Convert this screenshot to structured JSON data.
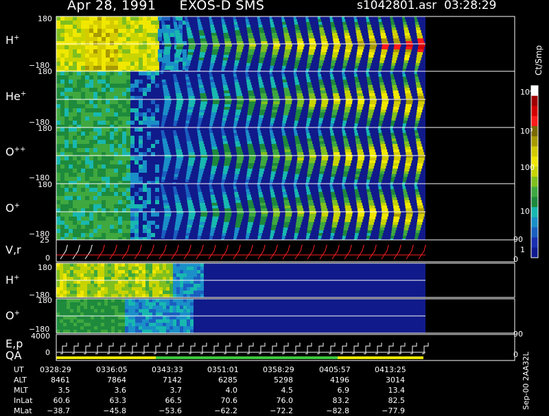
{
  "header": {
    "date": "Apr 28, 1991",
    "instrument": "EXOS-D SMS",
    "file": "s1042801.asr",
    "time": "03:28:29"
  },
  "panels": [
    {
      "label": "H",
      "sup": "+",
      "top_tick": "180",
      "bottom_tick": "−180"
    },
    {
      "label": "He",
      "sup": "+",
      "top_tick": "180",
      "bottom_tick": "−180"
    },
    {
      "label": "O",
      "sup": "++",
      "top_tick": "180",
      "bottom_tick": "−180"
    },
    {
      "label": "O",
      "sup": "+",
      "top_tick": "180",
      "bottom_tick": "−180"
    }
  ],
  "vr_panel": {
    "label": "V,r",
    "top_tick": "25",
    "bottom_tick": "0",
    "right_top": "90",
    "right_bottom": "0"
  },
  "lower_panels": [
    {
      "label": "H",
      "sup": "+",
      "top_tick": "180",
      "bottom_tick": "−180"
    },
    {
      "label": "O",
      "sup": "+",
      "top_tick": "180",
      "bottom_tick": "−180"
    }
  ],
  "ep_panel": {
    "label1": "E,p",
    "label2": "QA",
    "top_tick": "4000",
    "bottom_tick": "0",
    "right_top": "90",
    "right_bottom": "0"
  },
  "colorbar": {
    "unit": "Ct/Smp",
    "ticks": [
      "10⁴",
      "10³",
      "100",
      "10",
      "1"
    ],
    "colors": [
      "#ffffff",
      "#a00000",
      "#d40000",
      "#ff1a1a",
      "#7a6a00",
      "#a89a00",
      "#d4cc00",
      "#f0e800",
      "#c8d400",
      "#7fbf1f",
      "#3fa83f",
      "#1e8a3c",
      "#18b8b0",
      "#1a8fc8",
      "#1a5fc0",
      "#1a2fb0",
      "#101a90"
    ]
  },
  "footer_note": "Sep-00  2AA32L",
  "table": {
    "row_labels": [
      "UT",
      "ALT",
      "MLT",
      "InLat",
      "MLat"
    ],
    "columns": [
      [
        "0328:29",
        "8461",
        "3.5",
        "60.6",
        "−38.7"
      ],
      [
        "0336:05",
        "7864",
        "3.6",
        "63.3",
        "−45.8"
      ],
      [
        "0343:33",
        "7142",
        "3.7",
        "66.5",
        "−53.6"
      ],
      [
        "0351:01",
        "6285",
        "4.0",
        "70.6",
        "−62.2"
      ],
      [
        "0358:29",
        "5298",
        "4.5",
        "76.0",
        "−72.2"
      ],
      [
        "0405:57",
        "4196",
        "6.9",
        "83.2",
        "−82.8"
      ],
      [
        "0413:25",
        "3014",
        "13.4",
        "82.5",
        "−77.9"
      ]
    ]
  },
  "chart_data": {
    "type": "heatmap",
    "title": "Apr 28, 1991   EXOS-D SMS",
    "x_tick_labels": [
      "0328:29",
      "0336:05",
      "0343:33",
      "0351:01",
      "0358:29",
      "0405:57",
      "0413:25"
    ],
    "series": [
      {
        "name": "H+",
        "ylim": [
          -180,
          180
        ]
      },
      {
        "name": "He+",
        "ylim": [
          -180,
          180
        ]
      },
      {
        "name": "O++",
        "ylim": [
          -180,
          180
        ]
      },
      {
        "name": "O+",
        "ylim": [
          -180,
          180
        ]
      },
      {
        "name": "V,r",
        "ylim": [
          0,
          25
        ]
      },
      {
        "name": "H+",
        "ylim": [
          -180,
          180
        ]
      },
      {
        "name": "O+",
        "ylim": [
          -180,
          180
        ]
      },
      {
        "name": "E,p",
        "ylim": [
          0,
          4000
        ]
      }
    ],
    "colorbar_label": "Ct/Smp",
    "colorbar_range": [
      1,
      10000
    ],
    "colorbar_scale": "log"
  }
}
